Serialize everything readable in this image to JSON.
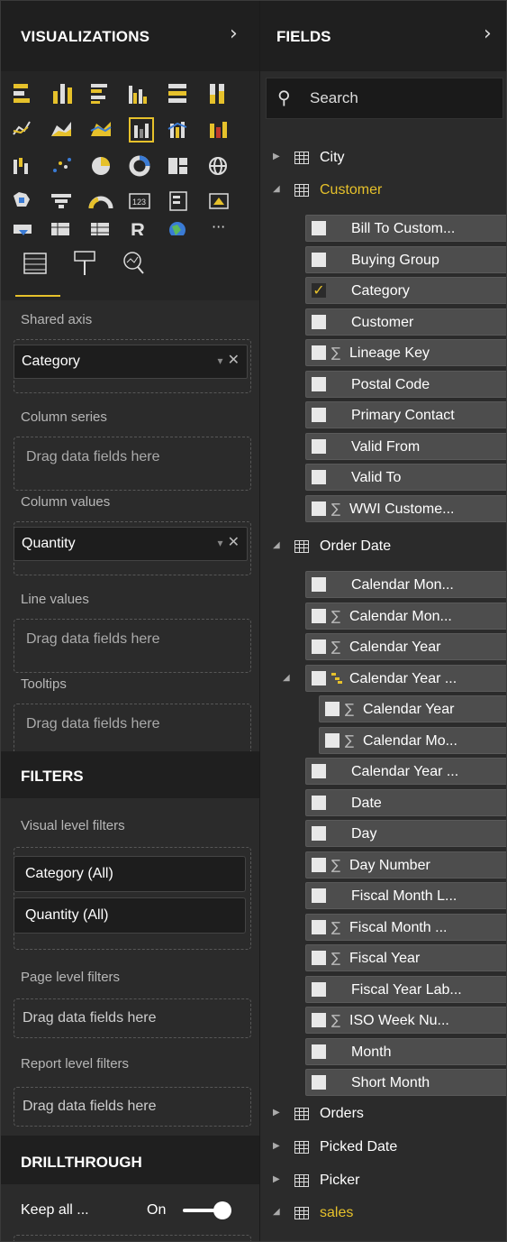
{
  "visualizations": {
    "title": "VISUALIZATIONS",
    "collapse_icon": "chevron-right-icon",
    "chart_icons": [
      "stacked-bar-chart-icon",
      "stacked-column-chart-icon",
      "clustered-bar-chart-icon",
      "clustered-column-chart-icon",
      "100-stacked-bar-chart-icon",
      "100-stacked-column-chart-icon",
      "line-chart-icon",
      "area-chart-icon",
      "stacked-area-chart-icon",
      "line-and-clustered-column-chart-icon",
      "line-and-stacked-column-chart-icon",
      "ribbon-chart-icon",
      "waterfall-chart-icon",
      "scatter-chart-icon",
      "pie-chart-icon",
      "donut-chart-icon",
      "treemap-icon",
      "map-icon",
      "filled-map-icon",
      "funnel-icon",
      "gauge-icon",
      "card-icon",
      "multi-row-card-icon",
      "kpi-icon",
      "slicer-icon",
      "table-icon",
      "matrix-icon",
      "r-visual-icon",
      "arcgis-map-icon",
      "more-icon"
    ],
    "selected_icon": "line-and-clustered-column-chart-icon",
    "more_glyph": "···",
    "r_glyph": "R",
    "kpi_glyph": "123",
    "tabs": [
      "fields-tab-icon",
      "format-paint-roller-icon",
      "analytics-magnifier-icon"
    ],
    "wells": {
      "shared_axis": {
        "label": "Shared axis",
        "value": "Category"
      },
      "column_series": {
        "label": "Column series",
        "placeholder": "Drag data fields here"
      },
      "column_values": {
        "label": "Column values",
        "value": "Quantity"
      },
      "line_values": {
        "label": "Line values",
        "placeholder": "Drag data fields here"
      },
      "tooltips": {
        "label": "Tooltips",
        "placeholder": "Drag data fields here"
      }
    },
    "dropdown_glyph": "▾",
    "remove_glyph": "✕"
  },
  "filters": {
    "title": "FILTERS",
    "visual_level": {
      "label": "Visual level filters",
      "items": [
        "Category (All)",
        "Quantity (All)"
      ]
    },
    "page_level": {
      "label": "Page level filters",
      "placeholder": "Drag data fields here"
    },
    "report_level": {
      "label": "Report level filters",
      "placeholder": "Drag data fields here"
    }
  },
  "drillthrough": {
    "title": "DRILLTHROUGH",
    "keep_all_label": "Keep all ...",
    "toggle_state": "On",
    "toggle_on": true
  },
  "fields": {
    "title": "FIELDS",
    "collapse_icon": "chevron-right-icon",
    "search_placeholder": "Search",
    "tables": {
      "city": {
        "name": "City",
        "expanded": false
      },
      "customer": {
        "name": "Customer",
        "expanded": true,
        "fields": [
          {
            "name": "Bill To Custom...",
            "sigma": false,
            "checked": false
          },
          {
            "name": "Buying Group",
            "sigma": false,
            "checked": false
          },
          {
            "name": "Category",
            "sigma": false,
            "checked": true
          },
          {
            "name": "Customer",
            "sigma": false,
            "checked": false
          },
          {
            "name": "Lineage Key",
            "sigma": true,
            "checked": false
          },
          {
            "name": "Postal Code",
            "sigma": false,
            "checked": false
          },
          {
            "name": "Primary Contact",
            "sigma": false,
            "checked": false
          },
          {
            "name": "Valid From",
            "sigma": false,
            "checked": false
          },
          {
            "name": "Valid To",
            "sigma": false,
            "checked": false
          },
          {
            "name": "WWI Custome...",
            "sigma": true,
            "checked": false
          }
        ]
      },
      "order_date": {
        "name": "Order Date",
        "expanded": true,
        "fields": [
          {
            "name": "Calendar Mon...",
            "sigma": false
          },
          {
            "name": "Calendar Mon...",
            "sigma": true
          },
          {
            "name": "Calendar Year",
            "sigma": true
          },
          {
            "name": "Calendar Year ...",
            "hierarchy": true
          },
          {
            "name": "Calendar Year",
            "sigma": true,
            "level": 2
          },
          {
            "name": "Calendar Mo...",
            "sigma": true,
            "level": 2
          },
          {
            "name": "Calendar Year ...",
            "sigma": false
          },
          {
            "name": "Date",
            "sigma": false
          },
          {
            "name": "Day",
            "sigma": false
          },
          {
            "name": "Day Number",
            "sigma": true
          },
          {
            "name": "Fiscal Month L...",
            "sigma": false
          },
          {
            "name": "Fiscal Month ...",
            "sigma": true
          },
          {
            "name": "Fiscal Year",
            "sigma": true
          },
          {
            "name": "Fiscal Year Lab...",
            "sigma": false
          },
          {
            "name": "ISO Week Nu...",
            "sigma": true
          },
          {
            "name": "Month",
            "sigma": false
          },
          {
            "name": "Short Month",
            "sigma": false
          }
        ]
      },
      "orders": {
        "name": "Orders",
        "expanded": false
      },
      "picked_date": {
        "name": "Picked Date",
        "expanded": false
      },
      "picker": {
        "name": "Picker",
        "expanded": false
      },
      "sales": {
        "name": "sales",
        "expanded": true
      }
    },
    "sigma_glyph": "∑",
    "check_glyph": "✓",
    "caret_collapsed": "▶",
    "caret_expanded": "◢"
  },
  "colors": {
    "accent": "#e6c12b",
    "header_bg": "#1f1f1f",
    "panel_bg": "#2b2b2b",
    "field_bg": "#4d4d4d"
  }
}
